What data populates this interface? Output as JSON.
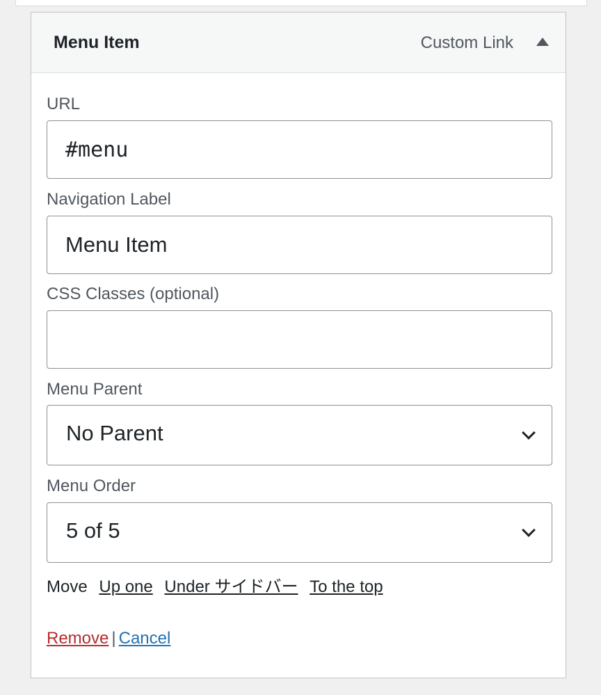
{
  "header": {
    "title": "Menu Item",
    "type_label": "Custom Link"
  },
  "fields": {
    "url": {
      "label": "URL",
      "value": "#menu"
    },
    "nav_label": {
      "label": "Navigation Label",
      "value": "Menu Item"
    },
    "css_classes": {
      "label": "CSS Classes (optional)",
      "value": ""
    },
    "menu_parent": {
      "label": "Menu Parent",
      "value": "No Parent"
    },
    "menu_order": {
      "label": "Menu Order",
      "value": "5 of 5"
    }
  },
  "move": {
    "label": "Move",
    "links": [
      "Up one",
      "Under サイドバー",
      "To the top"
    ]
  },
  "actions": {
    "remove": "Remove",
    "separator": "|",
    "cancel": "Cancel"
  },
  "colors": {
    "remove": "#b32d2e",
    "cancel": "#2271b1"
  }
}
